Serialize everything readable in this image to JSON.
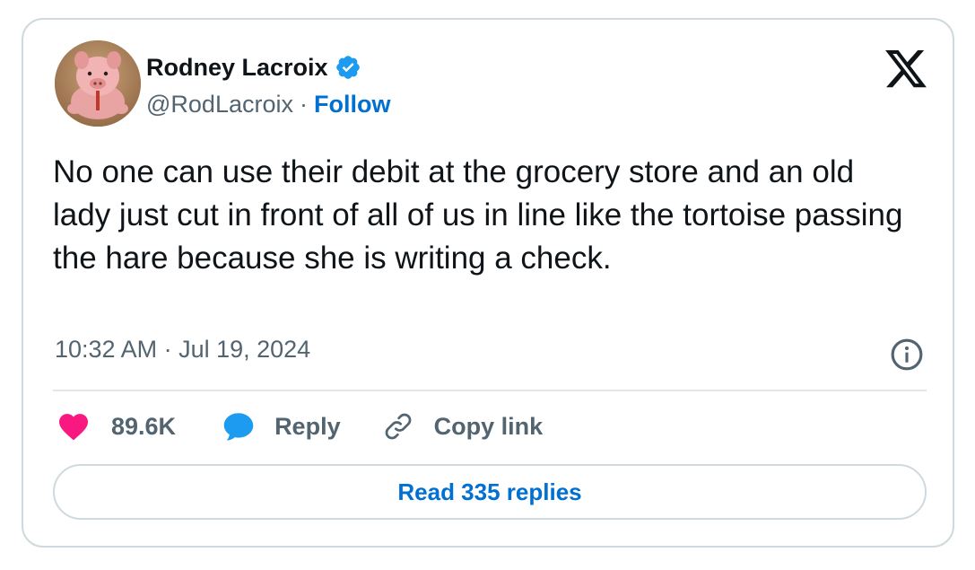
{
  "author": {
    "display_name": "Rodney Lacroix",
    "handle": "@RodLacroix",
    "separator": "·",
    "follow_label": "Follow",
    "verified": true
  },
  "brand_icon": "x-logo-icon",
  "tweet": {
    "text": "No one can use their debit at the grocery store and an old lady just cut in front of all of us in line like the tortoise passing the hare because she is writing a check.",
    "timestamp": "10:32 AM · Jul 19, 2024"
  },
  "actions": {
    "like_count": "89.6K",
    "reply_label": "Reply",
    "copy_link_label": "Copy link"
  },
  "read_replies_label": "Read 335 replies",
  "colors": {
    "accent": "#0070d2",
    "verified": "#1d9bf0",
    "like": "#f91880",
    "reply": "#1d9bf0",
    "secondary_text": "#536471",
    "border": "#cfd9de"
  }
}
